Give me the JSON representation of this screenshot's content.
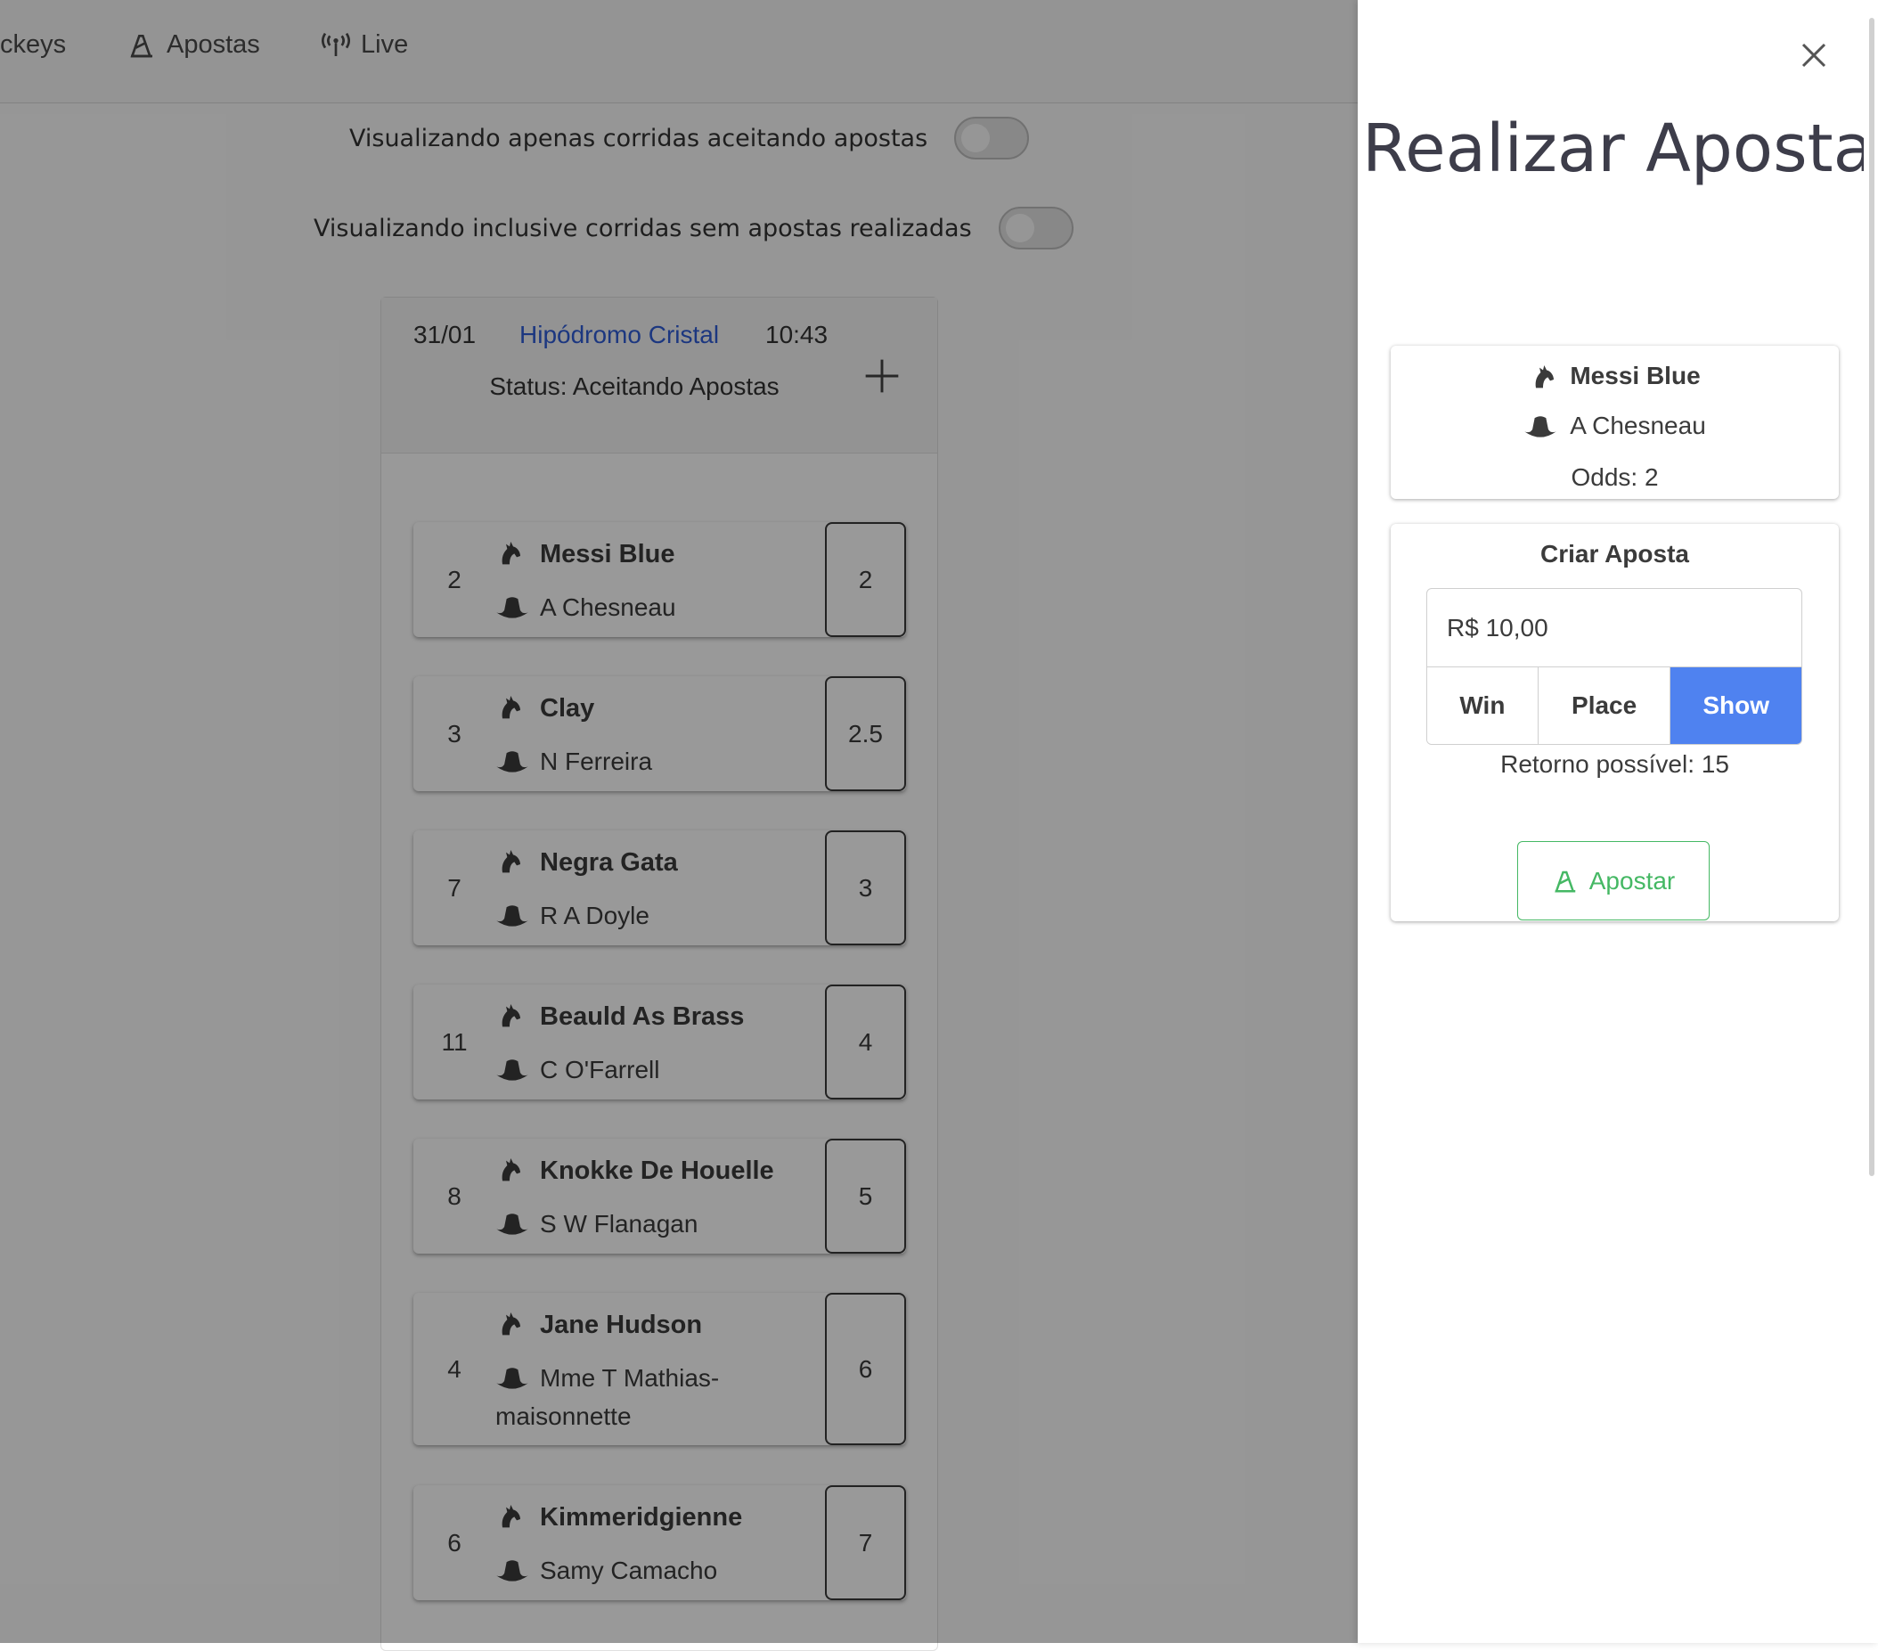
{
  "nav": {
    "items": [
      {
        "label": "ckeys",
        "icon": "none"
      },
      {
        "label": "Apostas",
        "icon": "bet-icon"
      },
      {
        "label": "Live",
        "icon": "antenna-icon"
      }
    ]
  },
  "filters": {
    "accepting_label": "Visualizando apenas corridas aceitando apostas",
    "accepting_on": false,
    "no_bets_label": "Visualizando inclusive corridas sem apostas realizadas",
    "no_bets_on": false
  },
  "race": {
    "date": "31/01",
    "venue": "Hipódromo Cristal",
    "time": "10:43",
    "status": "Status: Aceitando Apostas",
    "horses": [
      {
        "number": "2",
        "name": "Messi Blue",
        "jockey": "A Chesneau",
        "odds": "2"
      },
      {
        "number": "3",
        "name": "Clay",
        "jockey": "N Ferreira",
        "odds": "2.5"
      },
      {
        "number": "7",
        "name": "Negra Gata",
        "jockey": "R A Doyle",
        "odds": "3"
      },
      {
        "number": "11",
        "name": "Beauld As Brass",
        "jockey": "C O'Farrell",
        "odds": "4"
      },
      {
        "number": "8",
        "name": "Knokke De Houelle",
        "jockey": "S W Flanagan",
        "odds": "5"
      },
      {
        "number": "4",
        "name": "Jane Hudson",
        "jockey": "Mme T Mathias-maisonnette",
        "odds": "6"
      },
      {
        "number": "6",
        "name": "Kimmeridgienne",
        "jockey": "Samy Camacho",
        "odds": "7"
      }
    ]
  },
  "drawer": {
    "title": "Realizar Aposta",
    "selection": {
      "horse": "Messi Blue",
      "jockey": "A Chesneau",
      "odds": "Odds: 2"
    },
    "bet": {
      "title": "Criar Aposta",
      "amount": "R$ 10,00",
      "types": [
        "Win",
        "Place",
        "Show"
      ],
      "selected_type": "Show",
      "return": "Retorno possível: 15",
      "submit_label": "Apostar"
    }
  },
  "colors": {
    "accent_blue": "#4f82f0",
    "link_blue": "#2f5cd6",
    "success_green": "#45b864"
  }
}
